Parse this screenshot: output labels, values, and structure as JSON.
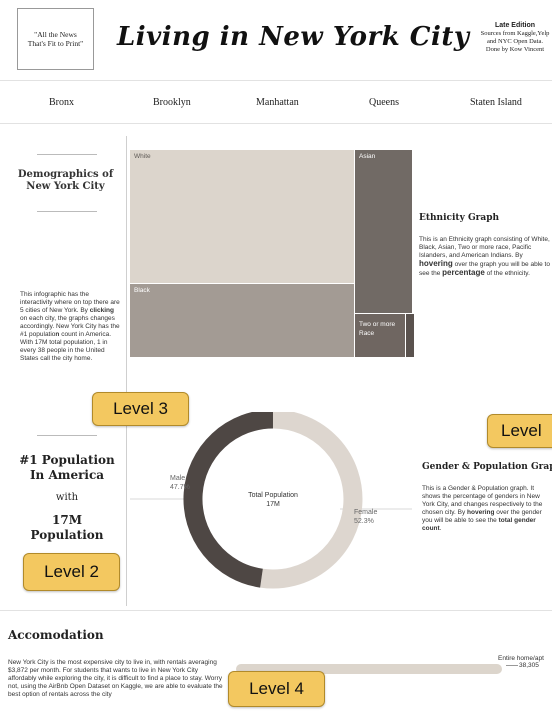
{
  "header": {
    "ear_text": "\"All the News\nThat's Fit to Print\"",
    "title": "Living in New York City",
    "edition_label": "Late Edition",
    "edition_sources": "Sources from Kaggle,Yelp and NYC Open Data.",
    "edition_credit": "Done by Kow Vincent"
  },
  "nav": [
    "Bronx",
    "Brooklyn",
    "Manhattan",
    "Queens",
    "Staten Island"
  ],
  "sidebar": {
    "section_title": "Demographics of New York City",
    "intro_pre": "This infographic has the interactivity where on top there are 5 cities of New York. By ",
    "intro_click": "clicking",
    "intro_mid": " on each city, the graphs changes accordingly. New York City has the #1 populatio",
    "intro_n": "n",
    "intro_post": " count in America. With 17M total population, 1 in every 38 people in the United States call the city home.",
    "rank": "#1 Population In America",
    "with": "with",
    "population": "17M Population"
  },
  "treemap": {
    "tiles": [
      {
        "label": "White",
        "color": "#dcd5cc"
      },
      {
        "label": "Asian",
        "color": "#716a65"
      },
      {
        "label": "Black",
        "color": "#a39b94"
      },
      {
        "label": "Two or more Race",
        "color": "#6f6661"
      },
      {
        "label": "",
        "color": "#5a524e"
      }
    ]
  },
  "ethnicity": {
    "title": "Ethnicity Graph",
    "desc_pre": "This is an Ethnicity graph consisting of White, Black, Asian, Two or more race, Pacific Islanders, and American Indians. By ",
    "desc_hover": "hovering",
    "desc_mid": " over the graph you will be able to see the ",
    "desc_pct": "percentage",
    "desc_post": " of the ethnicity."
  },
  "donut": {
    "center_label": "Total Population",
    "center_value": "17M",
    "male_label": "Male",
    "male_pct": "47.7%",
    "female_label": "Female",
    "female_pct": "52.3%",
    "male_share": 47.7,
    "male_color": "#4e4744",
    "female_color": "#ddd6cf"
  },
  "gender": {
    "title": "Gender & Population Graph",
    "desc_pre": "This is a Gender & Population graph. It shows the percentage of genders in New York City, and changes respectively to the chosen city. By ",
    "desc_hover": "hovering",
    "desc_mid": " over the gender you will be able to see the ",
    "desc_total": "total gender count",
    "desc_post": "."
  },
  "accommodation": {
    "title": "Accomodation",
    "desc": "New York City is the most expensive city to live in, with rentals averaging $3,872 per month. For students that wants to live in New York City affordably while exploring the city, it is difficult to find a place to stay. Worry not, using the AirBnb Open Dataset on Kaggle, we are able to evaluate the best option of rentals across the city",
    "bar_label": "Entire home/apt",
    "bar_value": "38,305"
  },
  "levels": [
    "Level 3",
    "Level 2",
    "Level 4",
    "Level"
  ]
}
